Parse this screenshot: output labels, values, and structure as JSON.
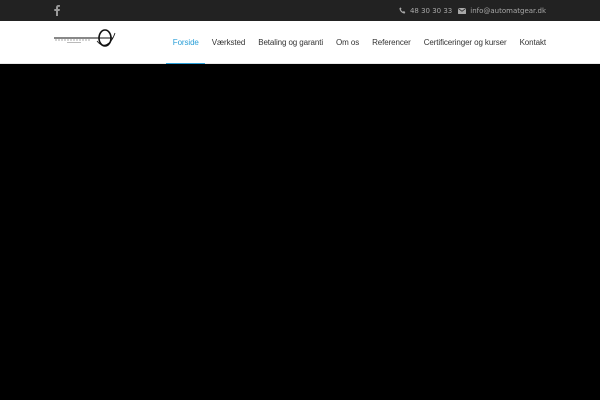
{
  "topbar": {
    "social": {
      "icon": "facebook-icon"
    },
    "phone": {
      "icon": "phone-icon",
      "text": "48 30 30 33"
    },
    "email": {
      "icon": "envelope-icon",
      "text": "info@automatgear.dk"
    }
  },
  "header": {
    "logo": {
      "icon": "logo-mark"
    }
  },
  "nav": {
    "items": [
      {
        "label": "Forside",
        "active": true
      },
      {
        "label": "Værksted",
        "active": false
      },
      {
        "label": "Betaling og garanti",
        "active": false
      },
      {
        "label": "Om os",
        "active": false
      },
      {
        "label": "Referencer",
        "active": false
      },
      {
        "label": "Certificeringer og kurser",
        "active": false
      },
      {
        "label": "Kontakt",
        "active": false
      }
    ]
  },
  "colors": {
    "topbar_bg": "#222222",
    "accent": "#2a9fd8",
    "hero_bg": "#000000"
  }
}
